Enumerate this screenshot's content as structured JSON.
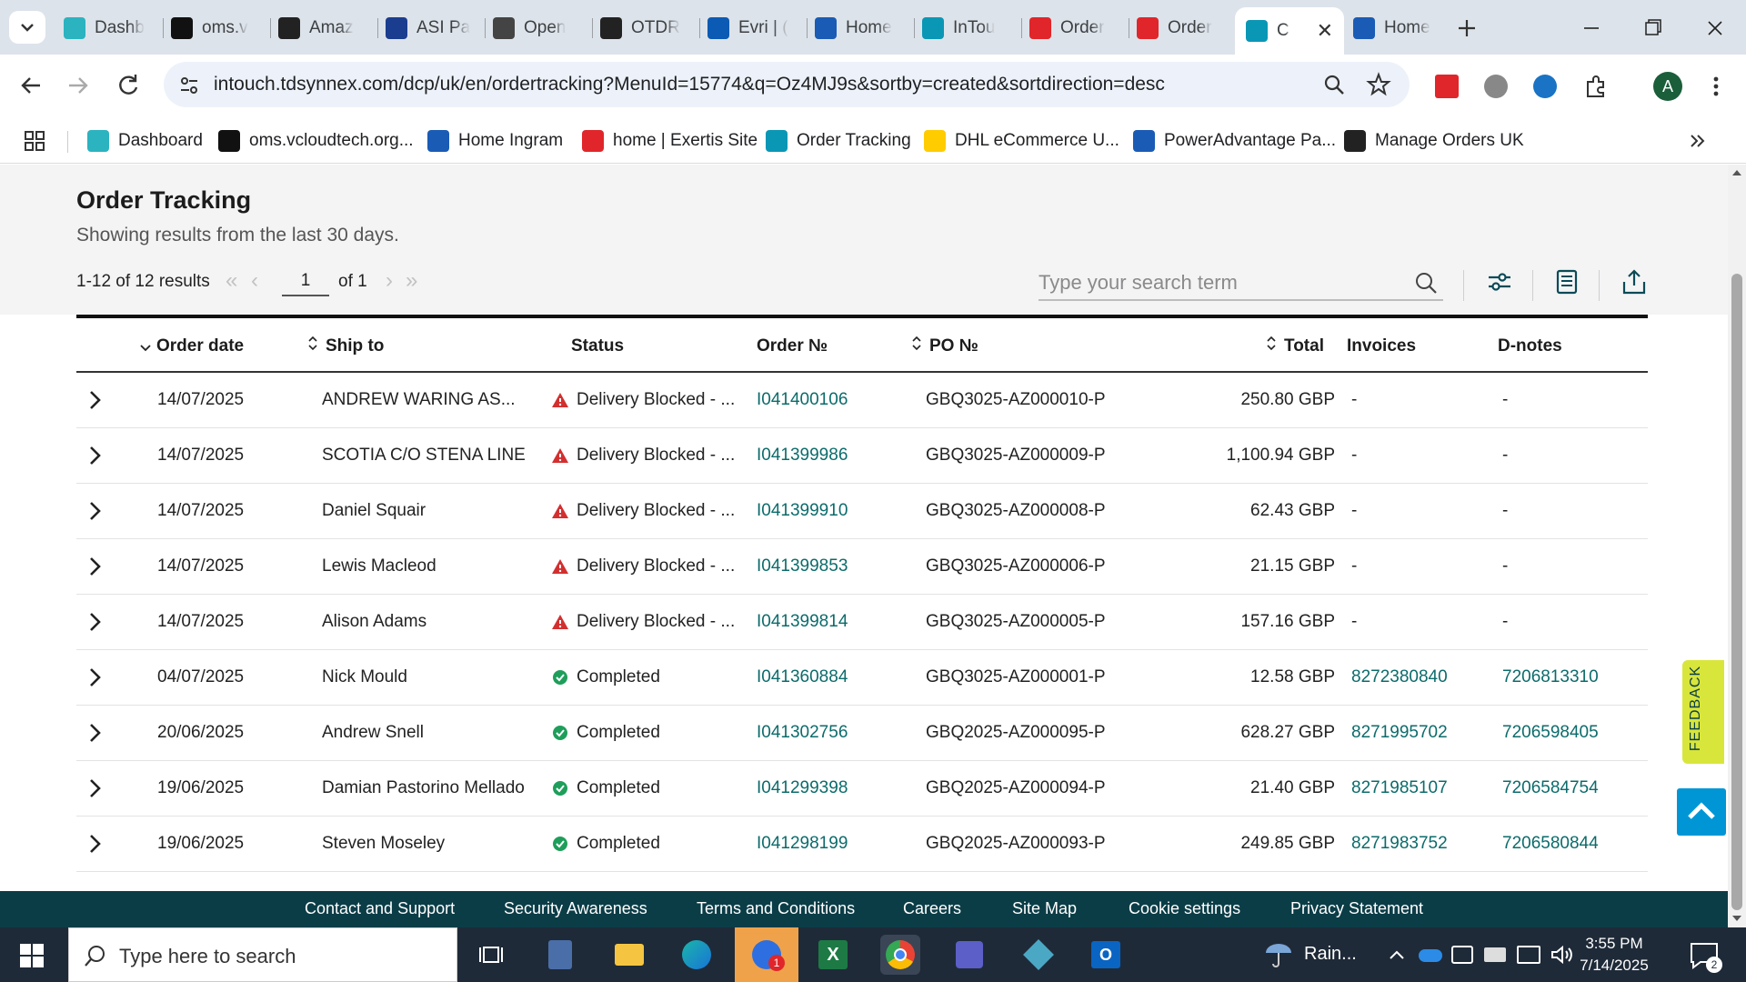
{
  "browser": {
    "tabs": [
      {
        "label": "Dashb",
        "icon": "diamond-icon",
        "color": "#2bb3c0"
      },
      {
        "label": "oms.v",
        "icon": "black-triangle-icon",
        "color": "#111111"
      },
      {
        "label": "Amaz",
        "icon": "amazon-icon",
        "color": "#222222"
      },
      {
        "label": "ASI Pa",
        "icon": "arrow-icon",
        "color": "#1a3d8f"
      },
      {
        "label": "Open",
        "icon": "openai-icon",
        "color": "#444444"
      },
      {
        "label": "OTDR",
        "icon": "openai-icon",
        "color": "#222222"
      },
      {
        "label": "Evri | (",
        "icon": "evri-icon",
        "color": "#0b5ab4"
      },
      {
        "label": "Home",
        "icon": "ingram-icon",
        "color": "#1a5bb5"
      },
      {
        "label": "InTou",
        "icon": "intouch-icon",
        "color": "#0a97b5"
      },
      {
        "label": "Order",
        "icon": "exertis-icon",
        "color": "#e0262a"
      },
      {
        "label": "Order",
        "icon": "exertis-icon",
        "color": "#e0262a"
      },
      {
        "label": "C",
        "icon": "intouch-icon",
        "color": "#0a97b5",
        "active": true
      },
      {
        "label": "Home",
        "icon": "ingram-icon",
        "color": "#1a5bb5"
      }
    ],
    "url": "intouch.tdsynnex.com/dcp/uk/en/ordertracking?MenuId=15774&q=Oz4MJ9s&sortby=created&sortdirection=desc",
    "profile_initial": "A",
    "bookmarks": [
      {
        "label": "Dashboard",
        "color": "#2bb3c0"
      },
      {
        "label": "oms.vcloudtech.org...",
        "color": "#111111"
      },
      {
        "label": "Home Ingram",
        "color": "#1a5bb5"
      },
      {
        "label": "home | Exertis Site",
        "color": "#e0262a"
      },
      {
        "label": "Order Tracking",
        "color": "#0a97b5"
      },
      {
        "label": "DHL eCommerce U...",
        "color": "#ffcc00"
      },
      {
        "label": "PowerAdvantage Pa...",
        "color": "#1a5bb5"
      },
      {
        "label": "Manage Orders UK",
        "color": "#222222"
      }
    ]
  },
  "page": {
    "title": "Order Tracking",
    "subtitle": "Showing results from the last 30 days.",
    "results_text": "1-12 of 12 results",
    "current_page": "1",
    "of_pages": "of 1",
    "search_placeholder": "Type your search term"
  },
  "table": {
    "headers": {
      "order_date": "Order date",
      "ship_to": "Ship to",
      "status": "Status",
      "order_no": "Order №",
      "po_no": "PO №",
      "total": "Total",
      "invoices": "Invoices",
      "dnotes": "D-notes"
    },
    "rows": [
      {
        "date": "14/07/2025",
        "ship_to": "ANDREW WARING AS...",
        "status": "Delivery Blocked - ...",
        "status_type": "blocked",
        "order": "I041400106",
        "po": "GBQ3025-AZ000010-P",
        "total": "250.80 GBP",
        "invoice": "-",
        "dnote": "-"
      },
      {
        "date": "14/07/2025",
        "ship_to": "SCOTIA C/O STENA LINE",
        "status": "Delivery Blocked - ...",
        "status_type": "blocked",
        "order": "I041399986",
        "po": "GBQ3025-AZ000009-P",
        "total": "1,100.94 GBP",
        "invoice": "-",
        "dnote": "-"
      },
      {
        "date": "14/07/2025",
        "ship_to": "Daniel Squair",
        "status": "Delivery Blocked - ...",
        "status_type": "blocked",
        "order": "I041399910",
        "po": "GBQ3025-AZ000008-P",
        "total": "62.43 GBP",
        "invoice": "-",
        "dnote": "-"
      },
      {
        "date": "14/07/2025",
        "ship_to": "Lewis Macleod",
        "status": "Delivery Blocked - ...",
        "status_type": "blocked",
        "order": "I041399853",
        "po": "GBQ3025-AZ000006-P",
        "total": "21.15 GBP",
        "invoice": "-",
        "dnote": "-"
      },
      {
        "date": "14/07/2025",
        "ship_to": "Alison Adams",
        "status": "Delivery Blocked - ...",
        "status_type": "blocked",
        "order": "I041399814",
        "po": "GBQ3025-AZ000005-P",
        "total": "157.16 GBP",
        "invoice": "-",
        "dnote": "-"
      },
      {
        "date": "04/07/2025",
        "ship_to": "Nick Mould",
        "status": "Completed",
        "status_type": "completed",
        "order": "I041360884",
        "po": "GBQ3025-AZ000001-P",
        "total": "12.58 GBP",
        "invoice": "8272380840",
        "dnote": "7206813310"
      },
      {
        "date": "20/06/2025",
        "ship_to": "Andrew Snell",
        "status": "Completed",
        "status_type": "completed",
        "order": "I041302756",
        "po": "GBQ2025-AZ000095-P",
        "total": "628.27 GBP",
        "invoice": "8271995702",
        "dnote": "7206598405"
      },
      {
        "date": "19/06/2025",
        "ship_to": "Damian Pastorino Mellado",
        "status": "Completed",
        "status_type": "completed",
        "order": "I041299398",
        "po": "GBQ2025-AZ000094-P",
        "total": "21.40 GBP",
        "invoice": "8271985107",
        "dnote": "7206584754"
      },
      {
        "date": "19/06/2025",
        "ship_to": "Steven Moseley",
        "status": "Completed",
        "status_type": "completed",
        "order": "I041298199",
        "po": "GBQ2025-AZ000093-P",
        "total": "249.85 GBP",
        "invoice": "8271983752",
        "dnote": "7206580844"
      }
    ]
  },
  "footer": {
    "links": [
      "Contact and Support",
      "Security Awareness",
      "Terms and Conditions",
      "Careers",
      "Site Map",
      "Cookie settings",
      "Privacy Statement"
    ]
  },
  "feedback_label": "FEEDBACK",
  "taskbar": {
    "search_placeholder": "Type here to search",
    "weather": "Rain...",
    "time": "3:55 PM",
    "date": "7/14/2025",
    "notification_count": "2",
    "zoom_badge": "1"
  },
  "colors": {
    "link": "#0c6b6b",
    "blocked": "#d32f2f",
    "completed": "#1e9e5a",
    "footer_bg": "#0b3d47",
    "feedback_bg": "#d8e63b",
    "to_top_bg": "#0096d6"
  }
}
